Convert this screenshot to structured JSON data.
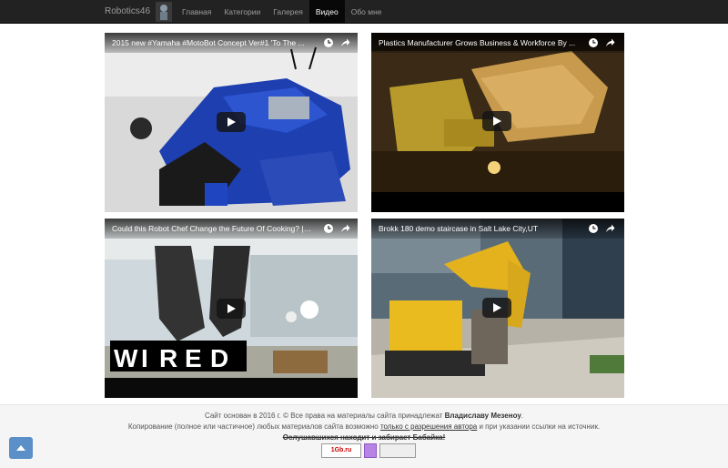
{
  "navbar": {
    "brand": "Robotics46",
    "items": [
      {
        "label": "Главная",
        "active": false
      },
      {
        "label": "Категории",
        "active": false
      },
      {
        "label": "Галерея",
        "active": false
      },
      {
        "label": "Видео",
        "active": true
      },
      {
        "label": "Обо мне",
        "active": false
      }
    ]
  },
  "videos": [
    {
      "title": "2015 new #Yamaha #MotoBot Concept Ver#1 'To The ..."
    },
    {
      "title": "Plastics Manufacturer Grows Business & Workforce By ..."
    },
    {
      "title": "Could this Robot Chef Change the Future Of Cooking? | ..."
    },
    {
      "title": "Brokk 180 demo staircase in Salt Lake City,UT"
    }
  ],
  "footer": {
    "line1_a": "Сайт основан в 2016 г. © Все права на материалы сайта принадлежат ",
    "line1_b": "Владиславу Мезеноу",
    "line1_c": ".",
    "line2_a": "Копирование (полное или частичное) любых материалов сайта возможно ",
    "line2_b": "только с разрешения автора",
    "line2_c": " и при указании ссылки на источник.",
    "line3": "Ослушавшихся находит и забирает Бабайка!",
    "counter1": "1Gb.ru",
    "counter2": "",
    "counter3": ""
  }
}
